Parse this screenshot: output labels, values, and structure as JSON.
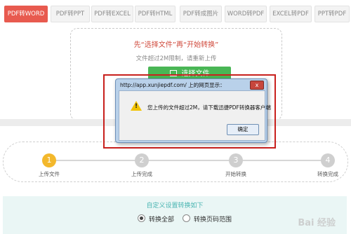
{
  "tabs": [
    "PDF转WORD",
    "PDF转PPT",
    "PDF转EXCEL",
    "PDF转HTML",
    "PDF转成图片",
    "WORD转PDF",
    "EXCEL转PDF",
    "PPT转PDF"
  ],
  "upload": {
    "title": "先“选择文件”再“开始转换”",
    "subtitle": "文件超过2M限制，请重新上传",
    "select_button": "选择文件"
  },
  "steps": [
    {
      "number": "1",
      "label": "上传文件"
    },
    {
      "number": "2",
      "label": "上传完成"
    },
    {
      "number": "3",
      "label": "开始转换"
    },
    {
      "number": "4",
      "label": "转换完成"
    }
  ],
  "custom": {
    "title": "自定义设置转换如下",
    "option_all": "转换全部",
    "option_range": "转换页码范围"
  },
  "dialog": {
    "title": "http://app.xunjiepdf.com/ 上的网页显示：",
    "message": "您上传的文件超过2M，请下载迅捷PDF转换器客户端",
    "ok_label": "确定",
    "close_label": "x"
  },
  "watermark": "Bai 经验"
}
